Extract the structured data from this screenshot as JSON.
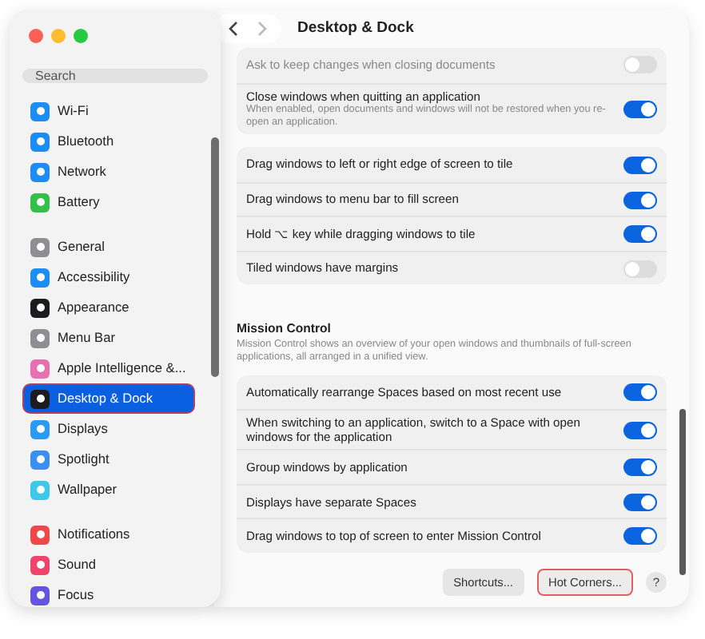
{
  "sidebar": {
    "search": {
      "placeholder": "Search"
    },
    "groups": [
      [
        {
          "label": "Wi-Fi",
          "color": "#1e8cf5",
          "selected": false
        },
        {
          "label": "Bluetooth",
          "color": "#1e8cf5",
          "selected": false
        },
        {
          "label": "Network",
          "color": "#1e8cf5",
          "selected": false
        },
        {
          "label": "Battery",
          "color": "#33c04a",
          "selected": false
        }
      ],
      [
        {
          "label": "General",
          "color": "#8e8e93",
          "selected": false
        },
        {
          "label": "Accessibility",
          "color": "#1e8cf5",
          "selected": false
        },
        {
          "label": "Appearance",
          "color": "#1c1c1e",
          "selected": false
        },
        {
          "label": "Menu Bar",
          "color": "#8e8e93",
          "selected": false
        },
        {
          "label": "Apple Intelligence &...",
          "color": "#e86fb0",
          "selected": false
        },
        {
          "label": "Desktop & Dock",
          "color": "#1c1c1e",
          "selected": true
        },
        {
          "label": "Displays",
          "color": "#2a9bf5",
          "selected": false
        },
        {
          "label": "Spotlight",
          "color": "#3b8ff0",
          "selected": false
        },
        {
          "label": "Wallpaper",
          "color": "#3cc8e8",
          "selected": false
        }
      ],
      [
        {
          "label": "Notifications",
          "color": "#f04848",
          "selected": false
        },
        {
          "label": "Sound",
          "color": "#f0456a",
          "selected": false
        },
        {
          "label": "Focus",
          "color": "#6355e0",
          "selected": false
        }
      ]
    ]
  },
  "header": {
    "title": "Desktop & Dock"
  },
  "groups": [
    {
      "rows": [
        {
          "label": "Ask to keep changes when closing documents",
          "on": false,
          "faded": true
        },
        {
          "label": "Close windows when quitting an application",
          "description": "When enabled, open documents and windows will not be restored when you re-open an application.",
          "on": true
        }
      ]
    },
    {
      "rows": [
        {
          "label": "Drag windows to left or right edge of screen to tile",
          "on": true
        },
        {
          "label": "Drag windows to menu bar to fill screen",
          "on": true
        },
        {
          "label": "Hold ⌥ key while dragging windows to tile",
          "on": true
        },
        {
          "label": "Tiled windows have margins",
          "on": false
        }
      ]
    },
    {
      "title": "Mission Control",
      "description": "Mission Control shows an overview of your open windows and thumbnails of full-screen applications, all arranged in a unified view.",
      "rows": [
        {
          "label": "Automatically rearrange Spaces based on most recent use",
          "on": true
        },
        {
          "label": "When switching to an application, switch to a Space with open windows for the application",
          "on": true
        },
        {
          "label": "Group windows by application",
          "on": true
        },
        {
          "label": "Displays have separate Spaces",
          "on": true
        },
        {
          "label": "Drag windows to top of screen to enter Mission Control",
          "on": true
        }
      ]
    }
  ],
  "buttons": [
    {
      "label": "Shortcuts...",
      "highlighted": false
    },
    {
      "label": "Hot Corners...",
      "highlighted": true
    }
  ],
  "help": "?"
}
